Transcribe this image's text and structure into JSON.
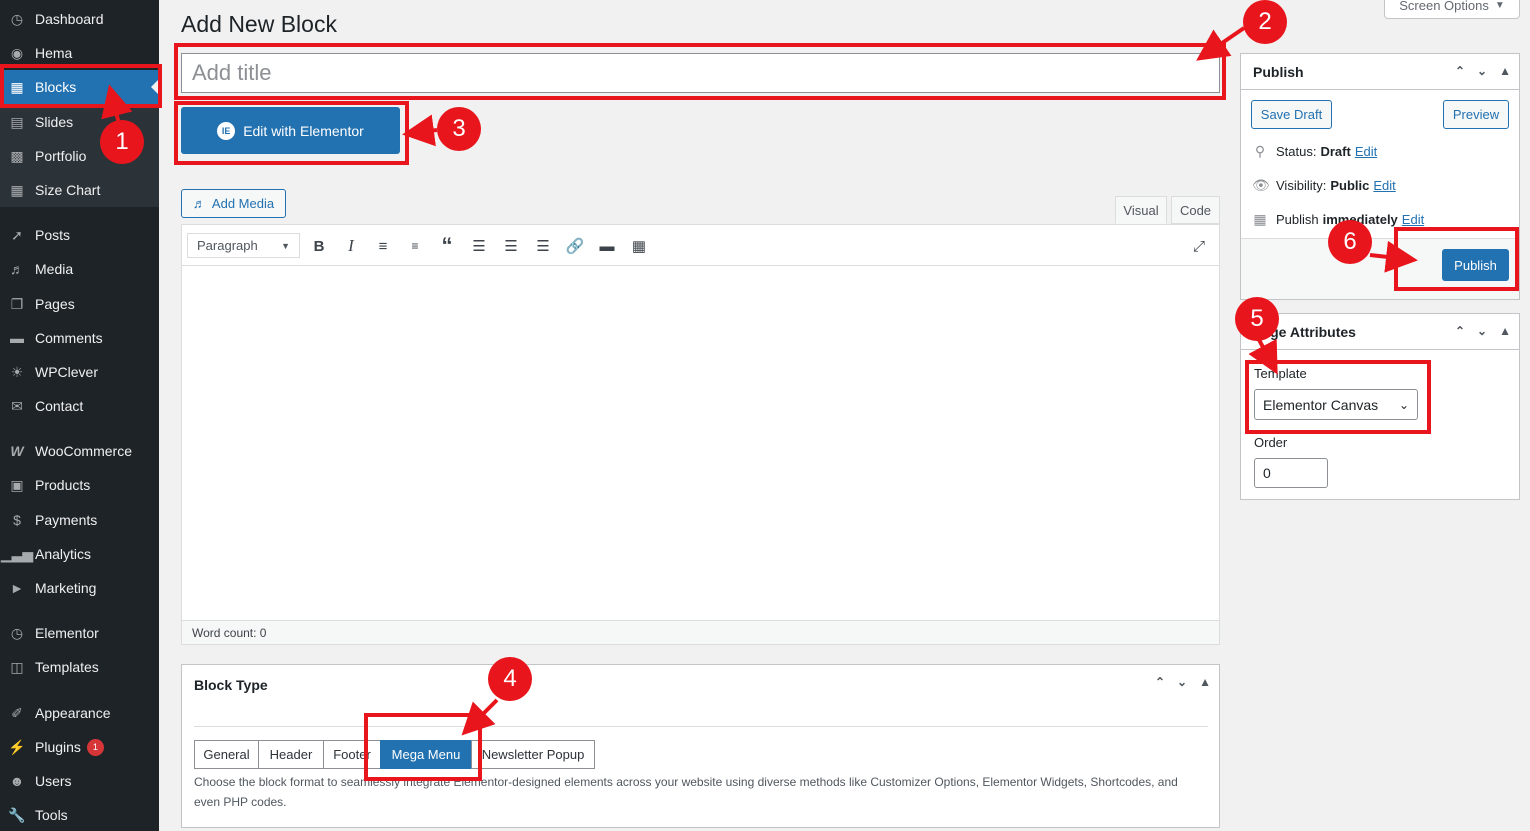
{
  "sidebar": {
    "items": [
      {
        "label": "Dashboard",
        "icon": "dashboard-icon"
      },
      {
        "label": "Hema",
        "icon": "hema-icon"
      },
      {
        "label": "Blocks",
        "icon": "blocks-icon"
      },
      {
        "label": "Slides",
        "icon": "slides-icon"
      },
      {
        "label": "Portfolio",
        "icon": "portfolio-icon"
      },
      {
        "label": "Size Chart",
        "icon": "size-chart-icon"
      },
      {
        "label": "Posts",
        "icon": "pin-icon"
      },
      {
        "label": "Media",
        "icon": "media-icon"
      },
      {
        "label": "Pages",
        "icon": "pages-icon"
      },
      {
        "label": "Comments",
        "icon": "comments-icon"
      },
      {
        "label": "WPClever",
        "icon": "wpclever-icon"
      },
      {
        "label": "Contact",
        "icon": "mail-icon"
      },
      {
        "label": "WooCommerce",
        "icon": "woocommerce-icon"
      },
      {
        "label": "Products",
        "icon": "products-icon"
      },
      {
        "label": "Payments",
        "icon": "payments-icon"
      },
      {
        "label": "Analytics",
        "icon": "analytics-icon"
      },
      {
        "label": "Marketing",
        "icon": "marketing-icon"
      },
      {
        "label": "Elementor",
        "icon": "elementor-icon"
      },
      {
        "label": "Templates",
        "icon": "folder-icon"
      },
      {
        "label": "Appearance",
        "icon": "appearance-icon"
      },
      {
        "label": "Plugins",
        "icon": "plugins-icon",
        "badge": "1"
      },
      {
        "label": "Users",
        "icon": "users-icon"
      },
      {
        "label": "Tools",
        "icon": "tools-icon"
      }
    ]
  },
  "header": {
    "title": "Add New Block",
    "screen_options": "Screen Options"
  },
  "editor": {
    "title_placeholder": "Add title",
    "elementor_button": "Edit with Elementor",
    "add_media": "Add Media",
    "tab_visual": "Visual",
    "tab_code": "Code",
    "format_select": "Paragraph",
    "word_count": "Word count: 0"
  },
  "publish": {
    "title": "Publish",
    "save_draft": "Save Draft",
    "preview": "Preview",
    "status_label": "Status:",
    "status_value": "Draft",
    "visibility_label": "Visibility:",
    "visibility_value": "Public",
    "publish_label": "Publish",
    "publish_value": "immediately",
    "edit_link": "Edit",
    "publish_button": "Publish"
  },
  "attributes": {
    "title": "Page Attributes",
    "template_label": "Template",
    "template_value": "Elementor Canvas",
    "order_label": "Order",
    "order_value": "0"
  },
  "block_type": {
    "title": "Block Type",
    "tabs": [
      "General",
      "Header",
      "Footer",
      "Mega Menu",
      "Newsletter Popup"
    ],
    "active": "Mega Menu",
    "description": "Choose the block format to seamlessly integrate Elementor-designed elements across your website using diverse methods like Customizer Options, Elementor Widgets, Shortcodes, and even PHP codes."
  },
  "annotations": [
    "1",
    "2",
    "3",
    "4",
    "5",
    "6"
  ],
  "colors": {
    "accent": "#2271b1",
    "sidebar": "#1d2327",
    "annotation": "#e8161c"
  }
}
